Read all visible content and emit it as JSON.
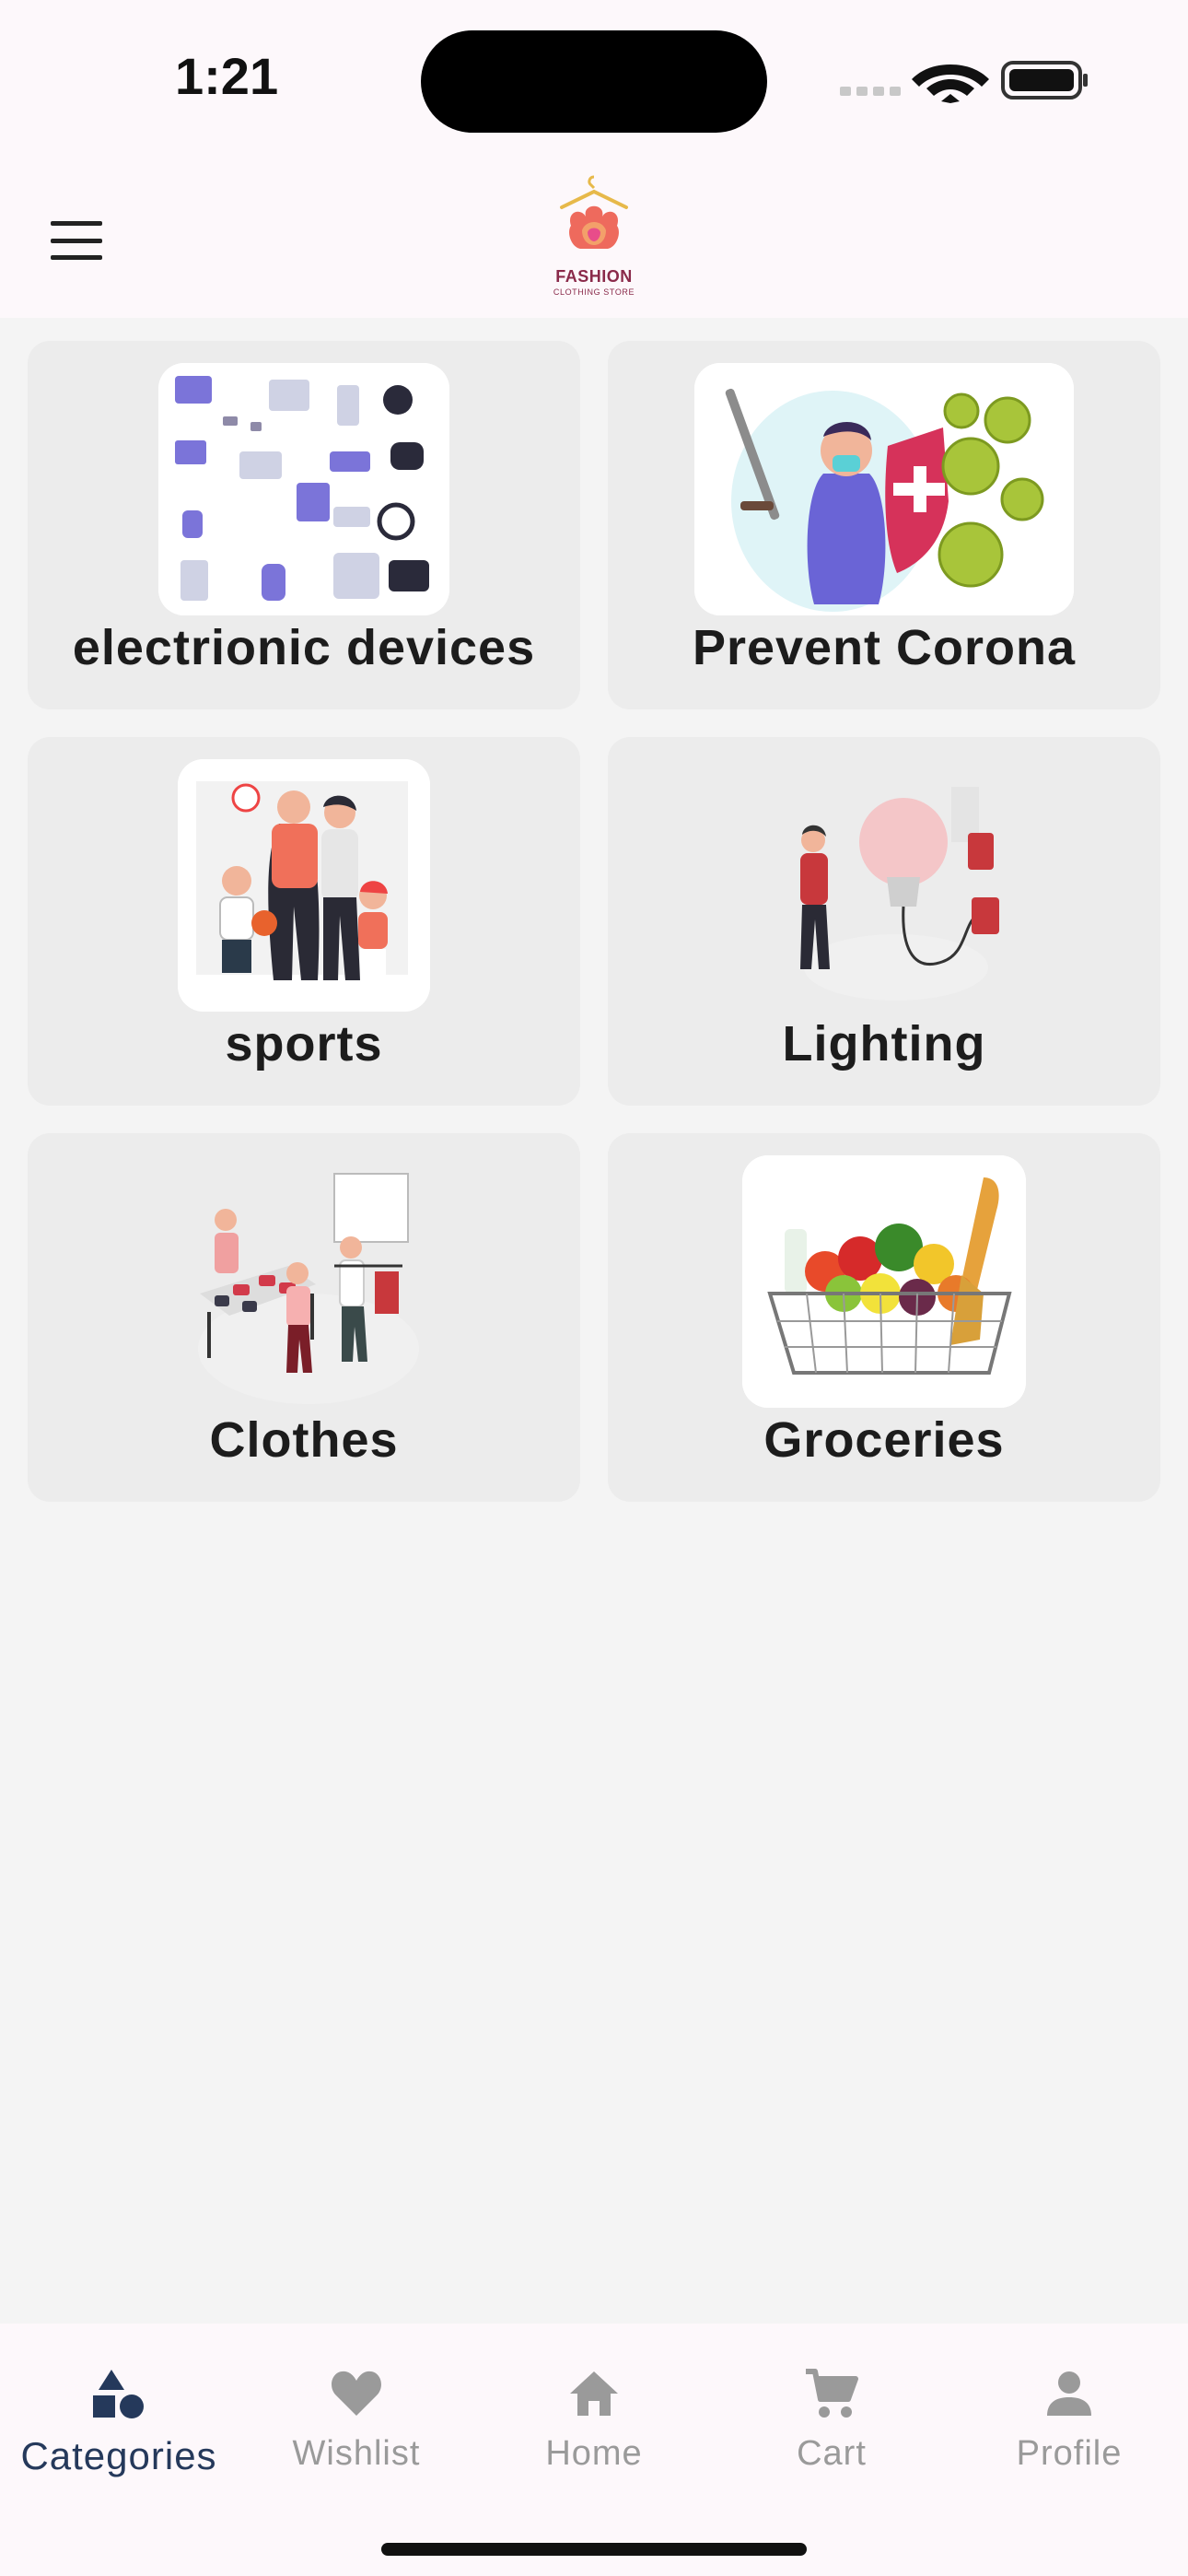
{
  "status_bar": {
    "time": "1:21"
  },
  "app_bar": {
    "logo_name": "FASHION",
    "logo_subtitle": "CLOTHING STORE"
  },
  "categories": [
    {
      "label": "electrionic devices"
    },
    {
      "label": "Prevent Corona"
    },
    {
      "label": "sports"
    },
    {
      "label": "Lighting"
    },
    {
      "label": "Clothes"
    },
    {
      "label": "Groceries"
    }
  ],
  "tab_bar": {
    "active": "Categories",
    "items": [
      {
        "label": "Categories",
        "icon": "shapes-icon"
      },
      {
        "label": "Wishlist",
        "icon": "heart-icon"
      },
      {
        "label": "Home",
        "icon": "home-icon"
      },
      {
        "label": "Cart",
        "icon": "cart-icon"
      },
      {
        "label": "Profile",
        "icon": "person-icon"
      }
    ]
  },
  "colors": {
    "active_tab": "#25395b",
    "inactive_tab": "#9a9a9a",
    "card_bg": "#ececec",
    "page_bg": "#f4f4f4"
  }
}
